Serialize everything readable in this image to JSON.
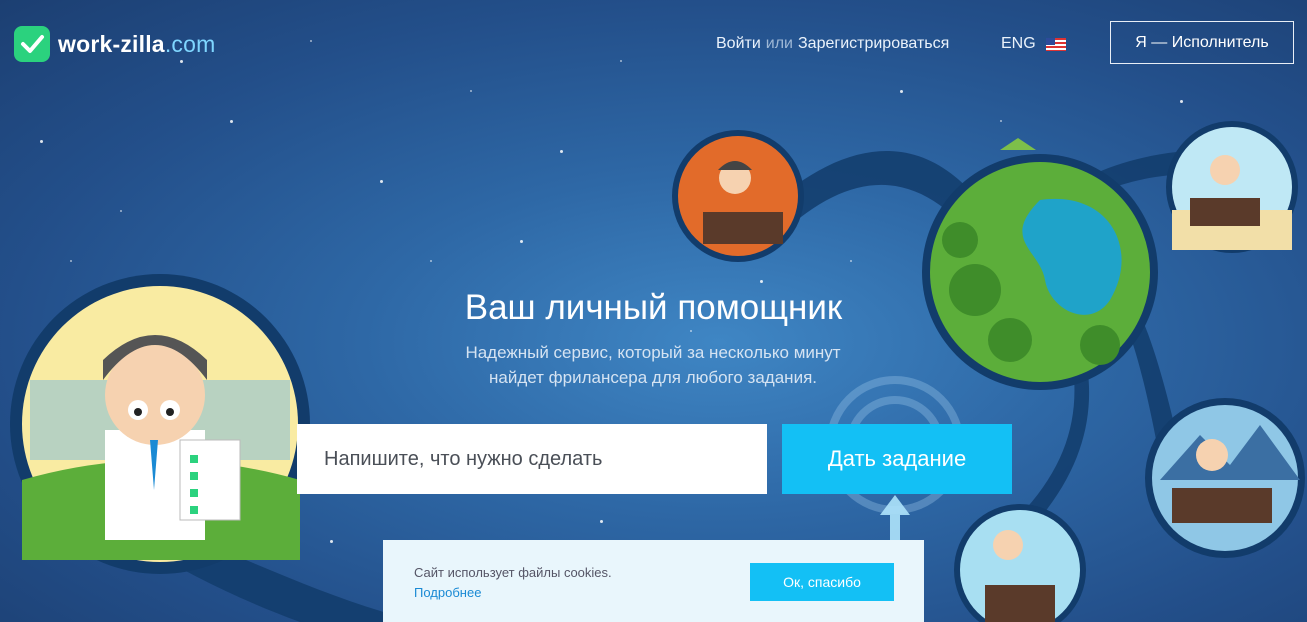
{
  "header": {
    "logo_text": "work-zilla",
    "logo_suffix": ".com",
    "login_label": "Войти",
    "or_label": "или",
    "register_label": "Зарегистрироваться",
    "lang_label": "ENG",
    "role_button_label": "Я — Исполнитель"
  },
  "hero": {
    "title": "Ваш личный помощник",
    "subtitle_line1": "Надежный сервис, который за несколько минут",
    "subtitle_line2": "найдет фрилансера для любого задания."
  },
  "search": {
    "placeholder": "Напишите, что нужно сделать",
    "value": ""
  },
  "task_button_label": "Дать задание",
  "cookie": {
    "text": "Сайт использует файлы cookies.",
    "more_link": "Подробнее",
    "accept_label": "Ок, спасибо"
  },
  "colors": {
    "accent": "#13c0f5",
    "logo_green": "#2bd27e",
    "bg_dark": "#1c3f72"
  }
}
